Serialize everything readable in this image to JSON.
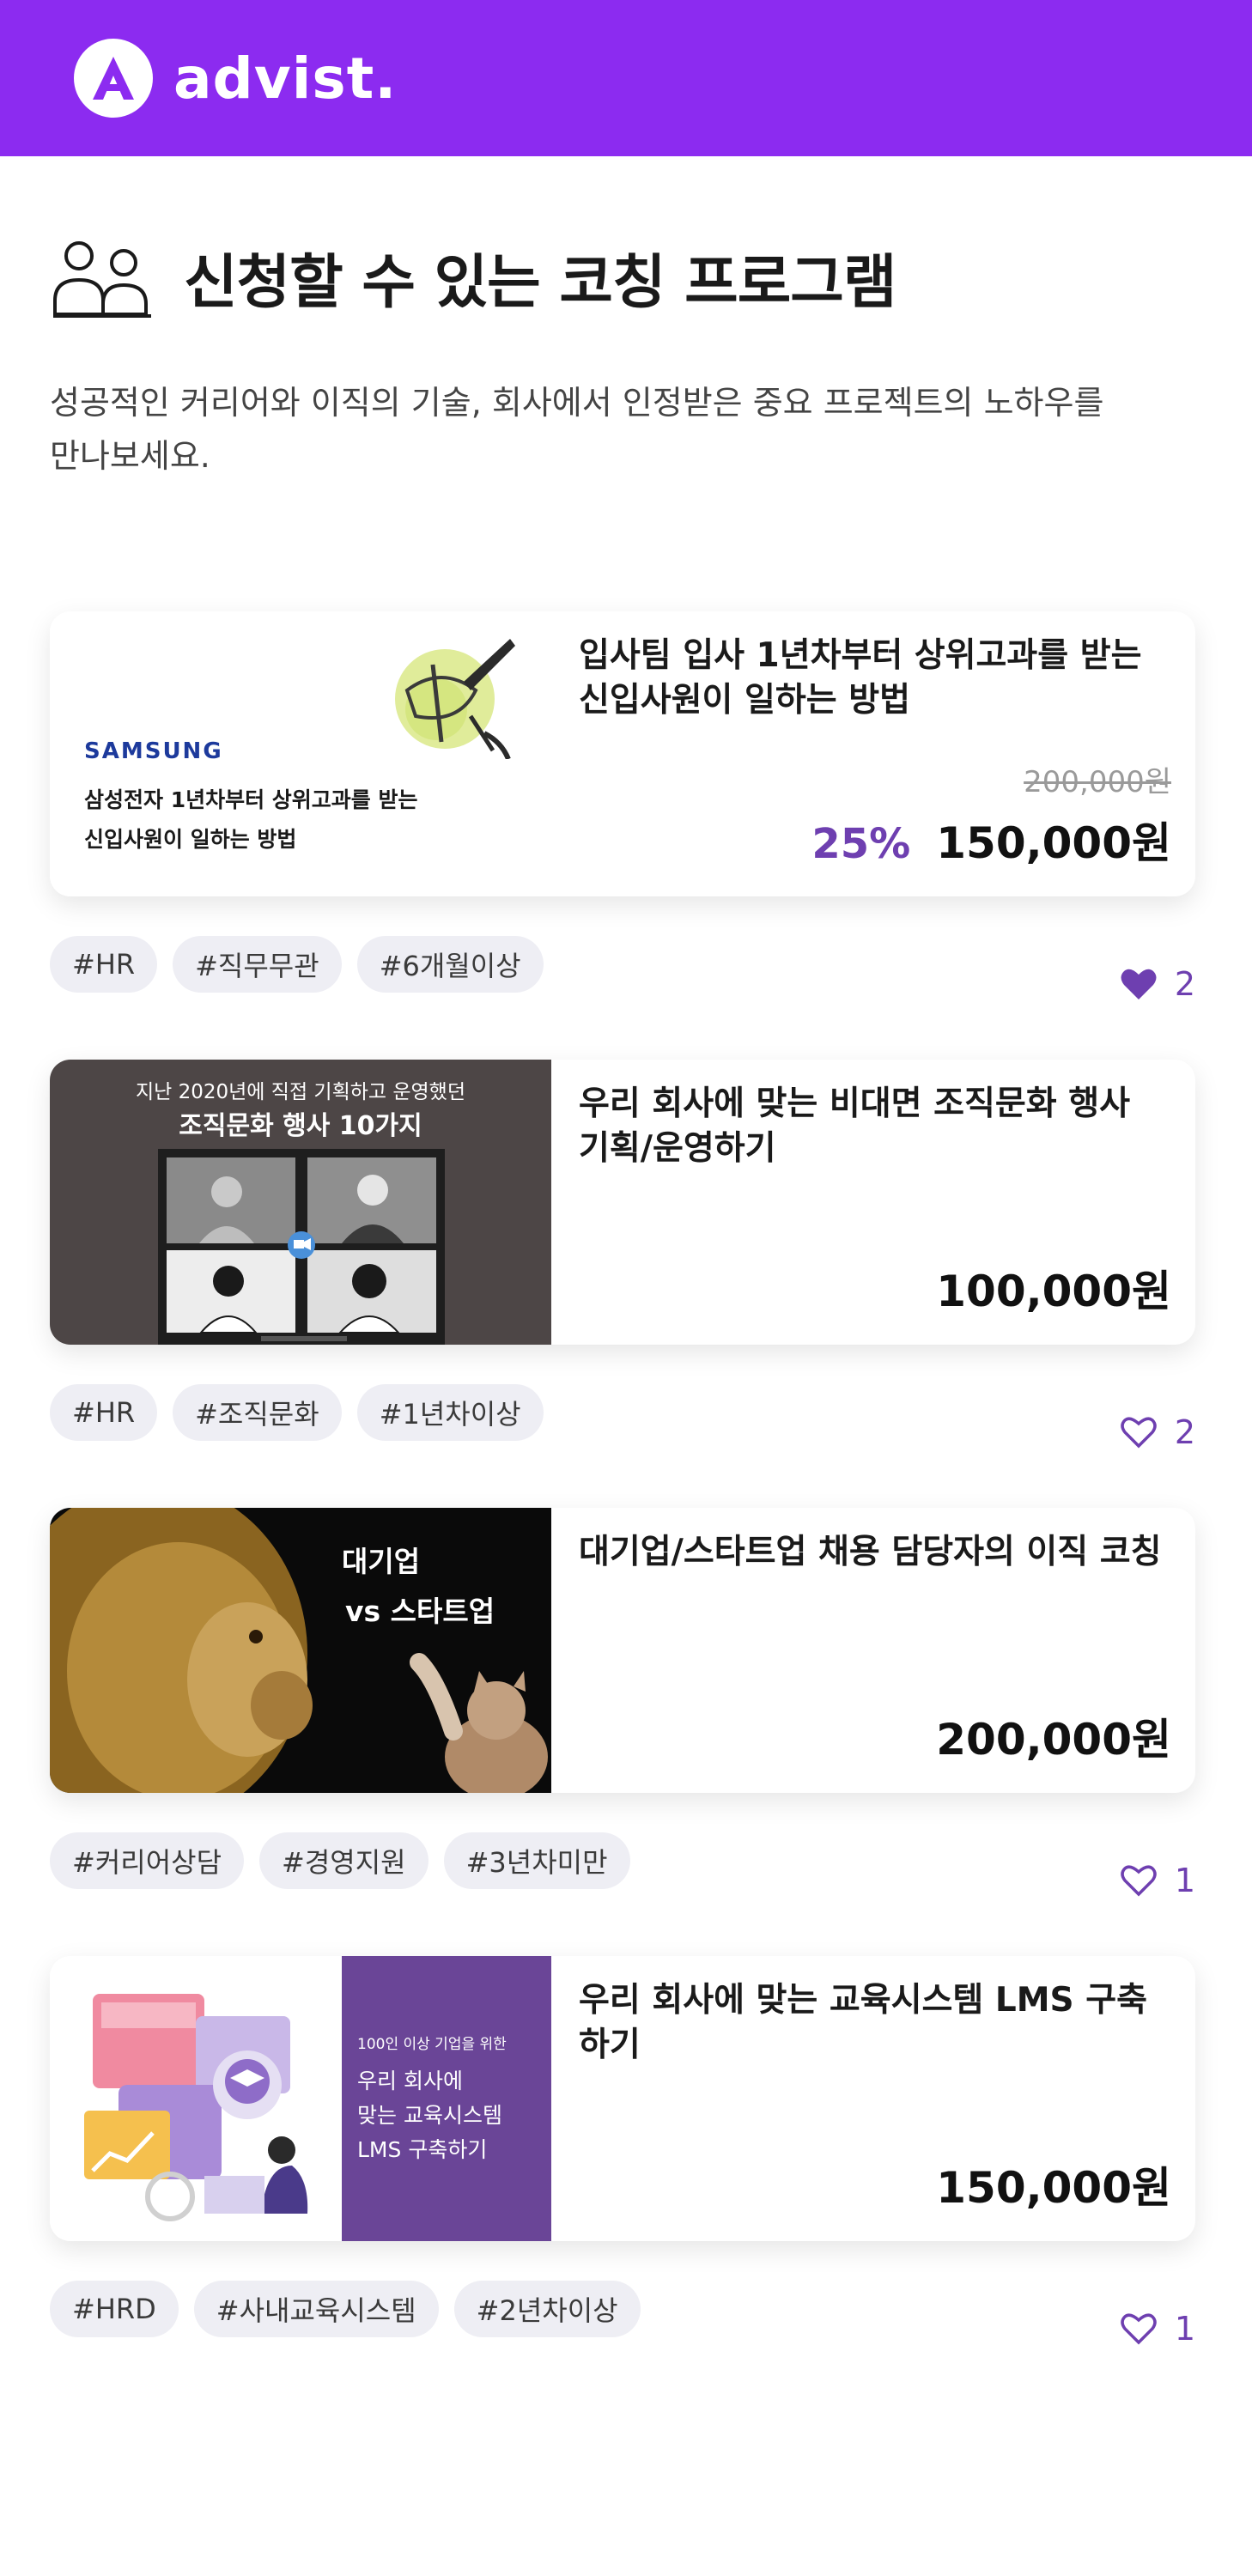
{
  "app": {
    "name": "advist.",
    "brand_color": "#8c2bf0",
    "accent_color": "#6e3fb0"
  },
  "intro": {
    "title": "신청할 수 있는 코칭 프로그램",
    "description": "성공적인 커리어와 이직의 기술, 회사에서 인정받은 중요 프로젝트의 노하우를 만나보세요."
  },
  "programs": [
    {
      "title": "입사팀 입사 1년차부터 상위고과를 받는 신입사원이 일하는 방법",
      "original_price": "200,000원",
      "discount": "25%",
      "price": "150,000원",
      "tags": [
        "#HR",
        "#직무무관",
        "#6개월이상"
      ],
      "likes": "2",
      "liked": true,
      "thumb": {
        "brand": "SAMSUNG",
        "line1": "삼성전자 1년차부터 상위고과를 받는",
        "line2": "신입사원이 일하는 방법"
      }
    },
    {
      "title": "우리 회사에 맞는 비대면 조직문화 행사 기획/운영하기",
      "original_price": "",
      "discount": "",
      "price": "100,000원",
      "tags": [
        "#HR",
        "#조직문화",
        "#1년차이상"
      ],
      "likes": "2",
      "liked": false,
      "thumb": {
        "caption1": "지난 2020년에 직접 기획하고 운영했던",
        "caption2": "조직문화 행사 10가지"
      }
    },
    {
      "title": "대기업/스타트업 채용 담당자의 이직 코칭",
      "original_price": "",
      "discount": "",
      "price": "200,000원",
      "tags": [
        "#커리어상담",
        "#경영지원",
        "#3년차미만"
      ],
      "likes": "1",
      "liked": false,
      "thumb": {
        "caption1": "대기업",
        "caption2": "vs 스타트업"
      }
    },
    {
      "title": "우리 회사에 맞는 교육시스템 LMS 구축하기",
      "original_price": "",
      "discount": "",
      "price": "150,000원",
      "tags": [
        "#HRD",
        "#사내교육시스템",
        "#2년차이상"
      ],
      "likes": "1",
      "liked": false,
      "thumb": {
        "caption1": "100인 이상 기업을 위한",
        "line1": "우리 회사에",
        "line2": "맞는 교육시스템",
        "line3": "LMS 구축하기"
      }
    }
  ]
}
